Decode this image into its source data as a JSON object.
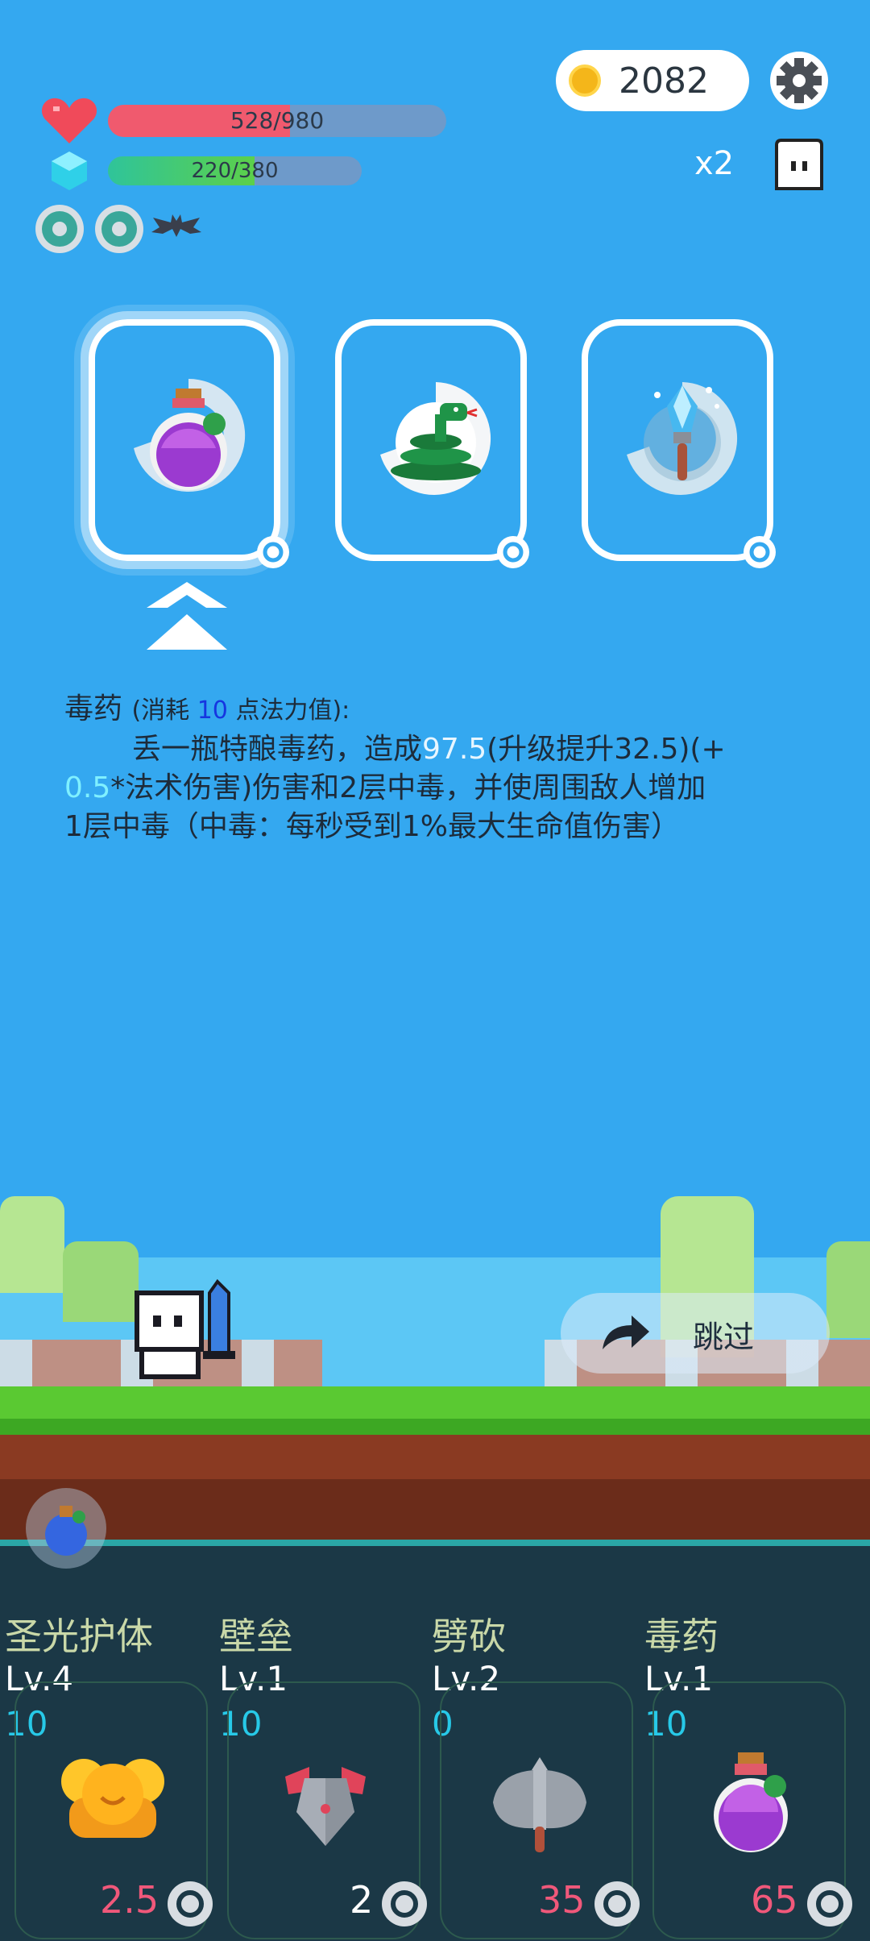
{
  "top": {
    "coins": "2082",
    "hp_text": "528/980",
    "hp_fraction": 0.539,
    "mp_text": "220/380",
    "mp_fraction": 0.579,
    "multiplier": "x2",
    "colors": {
      "hp": "#f05a6e",
      "mp": "#31c48d",
      "coin": "#f4b61a"
    }
  },
  "cards": [
    {
      "name": "poison-potion",
      "icon": "purple-potion-icon",
      "selected": true
    },
    {
      "name": "snake",
      "icon": "green-snake-icon",
      "selected": false
    },
    {
      "name": "ice-wand",
      "icon": "ice-crystal-wand-icon",
      "selected": false
    }
  ],
  "description": {
    "title": "毒药",
    "cost_prefix": "(消耗 ",
    "cost_value": "10",
    "cost_suffix": " 点法力值):",
    "line1_a": "丢一瓶特酿毒药，造成",
    "line1_dmg": "97.5",
    "line1_b": "(升级提升32.5)(+",
    "line2_ratio": "0.5",
    "line2_b": "*法术伤害)伤害和2层中毒，并使周围敌人增加",
    "line3": "1层中毒（中毒：每秒受到1%最大生命值伤害）"
  },
  "skip_label": "跳过",
  "slots": [
    {
      "name": "圣光护体",
      "level": "Lv.4",
      "mp": "10",
      "cost": "2.5",
      "cost_color": "#f0587a",
      "icon": "golden-shield-icon"
    },
    {
      "name": "壁垒",
      "level": "Lv.1",
      "mp": "10",
      "cost": "2",
      "cost_color": "#ffffff",
      "icon": "armor-icon"
    },
    {
      "name": "劈砍",
      "level": "Lv.2",
      "mp": "0",
      "cost": "35",
      "cost_color": "#f0587a",
      "icon": "axe-icon"
    },
    {
      "name": "毒药",
      "level": "Lv.1",
      "mp": "10",
      "cost": "65",
      "cost_color": "#f0587a",
      "icon": "purple-potion-icon"
    }
  ]
}
